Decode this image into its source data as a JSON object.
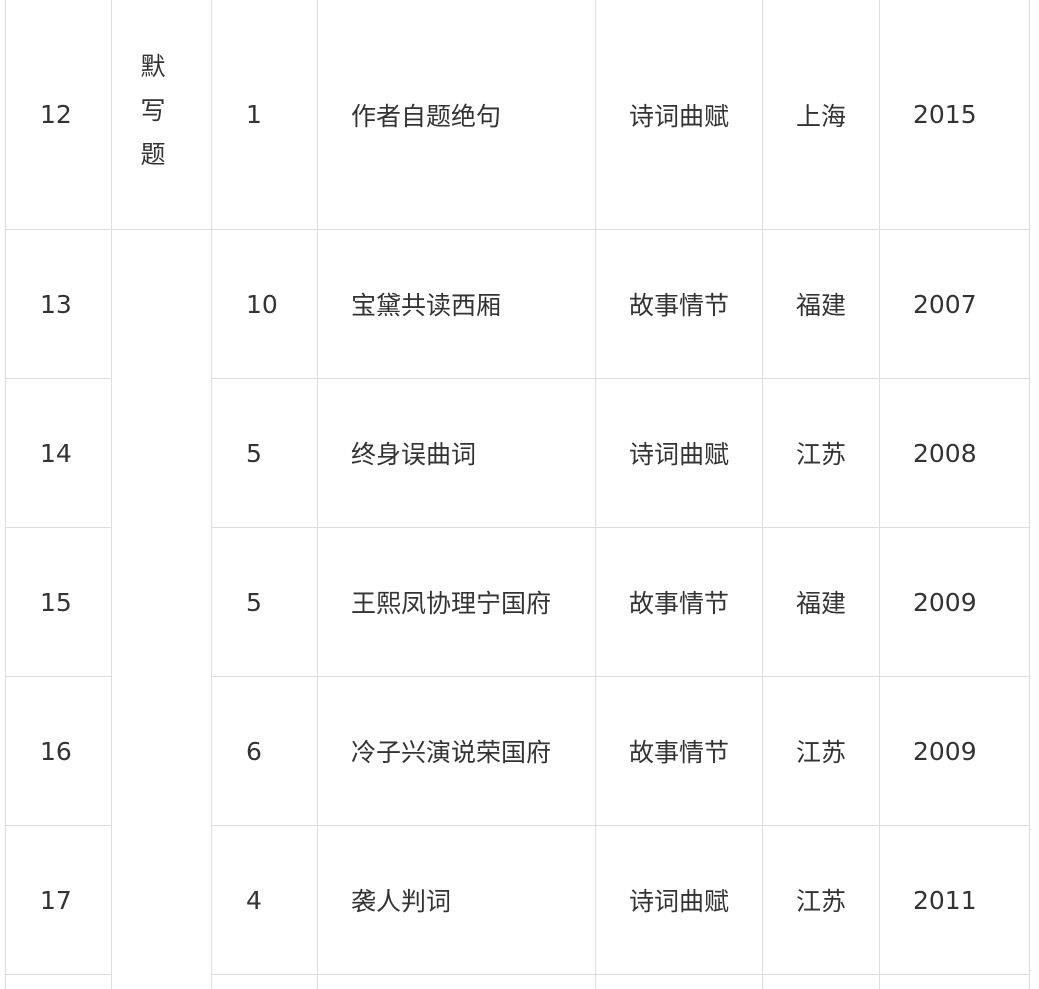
{
  "rows": [
    {
      "no": "12",
      "type": "默写题",
      "chapter": "1",
      "title": "作者自题绝句",
      "category": "诗词曲赋",
      "region": "上海",
      "year": "2015"
    },
    {
      "no": "13",
      "type": "",
      "chapter": "10",
      "title": "宝黛共读西厢",
      "category": "故事情节",
      "region": "福建",
      "year": "2007"
    },
    {
      "no": "14",
      "type": "",
      "chapter": "5",
      "title": "终身误曲词",
      "category": "诗词曲赋",
      "region": "江苏",
      "year": "2008"
    },
    {
      "no": "15",
      "type": "",
      "chapter": "5",
      "title": "王熙凤协理宁国府",
      "category": "故事情节",
      "region": "福建",
      "year": "2009"
    },
    {
      "no": "16",
      "type": "",
      "chapter": "6",
      "title": "冷子兴演说荣国府",
      "category": "故事情节",
      "region": "江苏",
      "year": "2009"
    },
    {
      "no": "17",
      "type": "",
      "chapter": "4",
      "title": "袭人判词",
      "category": "诗词曲赋",
      "region": "江苏",
      "year": "2011"
    }
  ]
}
